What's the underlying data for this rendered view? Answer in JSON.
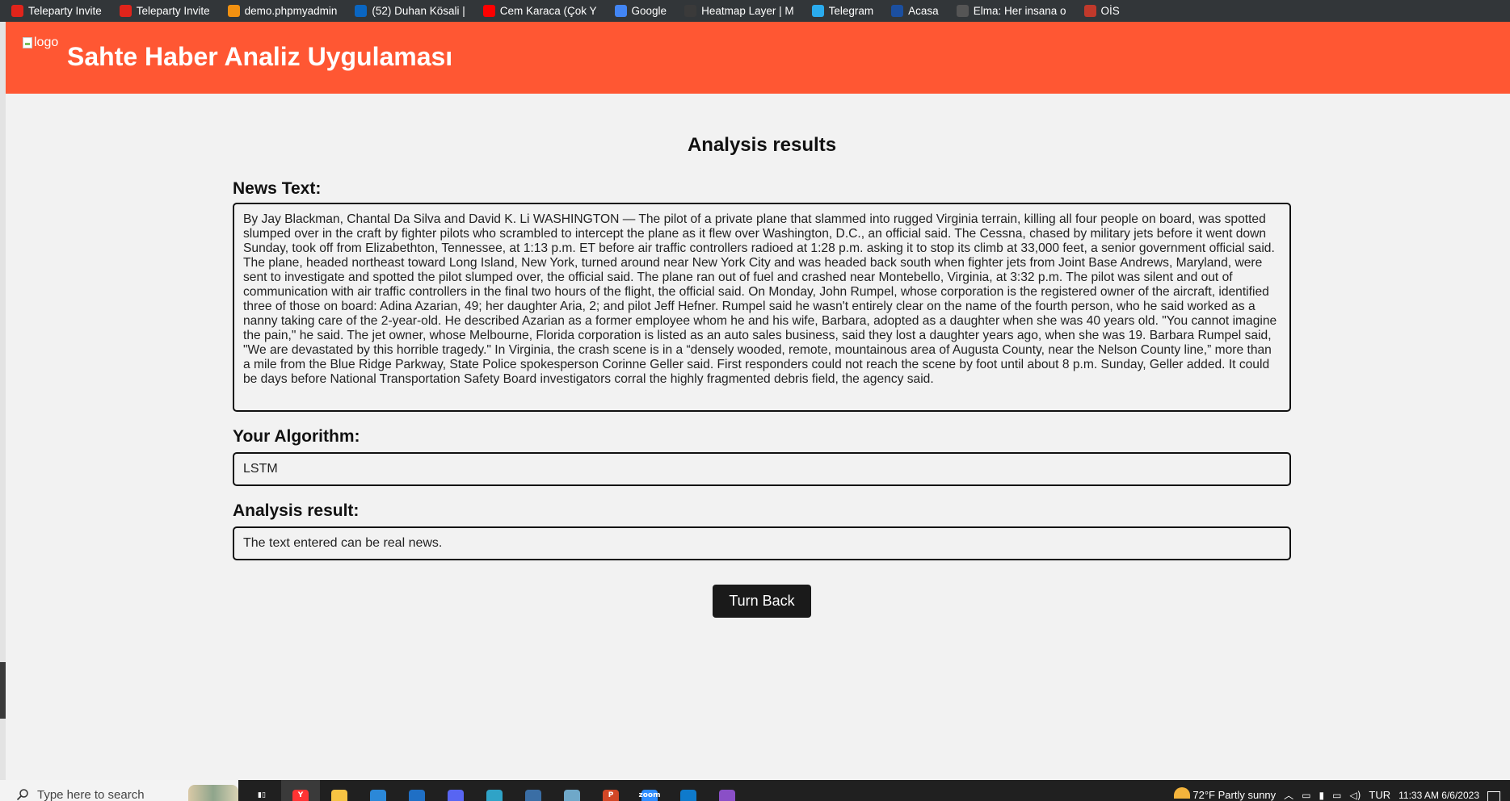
{
  "bookmarks": [
    {
      "label": "Teleparty Invite",
      "icon": "teleparty-icon",
      "color": "#e0241b"
    },
    {
      "label": "Teleparty Invite",
      "icon": "teleparty-icon",
      "color": "#e0241b"
    },
    {
      "label": "demo.phpmyadmin",
      "icon": "phpmyadmin-icon",
      "color": "#f29111"
    },
    {
      "label": "(52) Duhan Kösali |",
      "icon": "linkedin-icon",
      "color": "#0a66c2"
    },
    {
      "label": "Cem Karaca (Çok Y",
      "icon": "youtube-icon",
      "color": "#ff0000"
    },
    {
      "label": "Google",
      "icon": "google-icon",
      "color": "#4285f4"
    },
    {
      "label": "Heatmap Layer | M",
      "icon": "heatmap-icon",
      "color": "#3a3a3a"
    },
    {
      "label": "Telegram",
      "icon": "telegram-icon",
      "color": "#2aabee"
    },
    {
      "label": "Acasa",
      "icon": "acasa-icon",
      "color": "#1b4fa0"
    },
    {
      "label": "Elma: Her insana o",
      "icon": "page-icon",
      "color": "#555555"
    },
    {
      "label": "OİS",
      "icon": "ois-icon",
      "color": "#c0392b"
    }
  ],
  "header": {
    "logo_alt": "logo",
    "title": "Sahte Haber Analiz Uygulaması",
    "background": "#ff5733"
  },
  "main": {
    "page_title": "Analysis results",
    "news_label": "News Text:",
    "news_text": "By Jay Blackman, Chantal Da Silva and David K. Li WASHINGTON — The pilot of a private plane that slammed into rugged Virginia terrain, killing all four people on board, was spotted slumped over in the craft by fighter pilots who scrambled to intercept the plane as it flew over Washington, D.C., an official said. The Cessna, chased by military jets before it went down Sunday, took off from Elizabethton, Tennessee, at 1:13 p.m. ET before air traffic controllers radioed at 1:28 p.m. asking it to stop its climb at 33,000 feet, a senior government official said. The plane, headed northeast toward Long Island, New York, turned around near New York City and was headed back south when fighter jets from Joint Base Andrews, Maryland, were sent to investigate and spotted the pilot slumped over, the official said. The plane ran out of fuel and crashed near Montebello, Virginia, at 3:32 p.m. The pilot was silent and out of communication with air traffic controllers in the final two hours of the flight, the official said. On Monday, John Rumpel, whose corporation is the registered owner of the aircraft, identified three of those on board: Adina Azarian, 49; her daughter Aria, 2; and pilot Jeff Hefner. Rumpel said he wasn't entirely clear on the name of the fourth person, who he said worked as a nanny taking care of the 2-year-old. He described Azarian as a former employee whom he and his wife, Barbara, adopted as a daughter when she was 40 years old. \"You cannot imagine the pain,\" he said. The jet owner, whose Melbourne, Florida corporation is listed as an auto sales business, said they lost a daughter years ago, when she was 19. Barbara Rumpel said, \"We are devastated by this horrible tragedy.\" In Virginia, the crash scene is in a “densely wooded, remote, mountainous area of Augusta County, near the Nelson County line,” more than a mile from the Blue Ridge Parkway, State Police spokesperson Corinne Geller said. First responders could not reach the scene by foot until about 8 p.m. Sunday, Geller added. It could be days before National Transportation Safety Board investigators corral the highly fragmented debris field, the agency said.",
    "algorithm_label": "Your Algorithm:",
    "algorithm_value": "LSTM",
    "result_label": "Analysis result:",
    "result_value": "The text entered can be real news.",
    "back_button": "Turn Back"
  },
  "taskbar": {
    "search_placeholder": "Type here to search",
    "apps": [
      {
        "icon": "task-view-icon",
        "color": "#202020",
        "glyph": "▮▯"
      },
      {
        "icon": "yandex-browser-icon",
        "color": "#ff3333",
        "glyph": "Y",
        "active": true
      },
      {
        "icon": "file-explorer-icon",
        "color": "#f6c343",
        "glyph": ""
      },
      {
        "icon": "microsoft-store-icon",
        "color": "#2b88d8",
        "glyph": ""
      },
      {
        "icon": "mail-icon",
        "color": "#1f6fc5",
        "glyph": ""
      },
      {
        "icon": "discord-icon",
        "color": "#5865f2",
        "glyph": ""
      },
      {
        "icon": "edge-icon",
        "color": "#2fa3c7",
        "glyph": ""
      },
      {
        "icon": "pdf-viewer-icon",
        "color": "#3a6ea5",
        "glyph": ""
      },
      {
        "icon": "app-icon",
        "color": "#6fa8c9",
        "glyph": ""
      },
      {
        "icon": "powerpoint-icon",
        "color": "#d24726",
        "glyph": "P"
      },
      {
        "icon": "zoom-icon",
        "color": "#2d8cff",
        "glyph": "zoom"
      },
      {
        "icon": "vscode-icon",
        "color": "#0e7acc",
        "glyph": ""
      },
      {
        "icon": "github-desktop-icon",
        "color": "#8a4fc7",
        "glyph": ""
      }
    ],
    "weather_temp": "72°F",
    "weather_text": "Partly sunny",
    "language": "TUR",
    "time": "11:33 AM",
    "date": "6/6/2023"
  }
}
